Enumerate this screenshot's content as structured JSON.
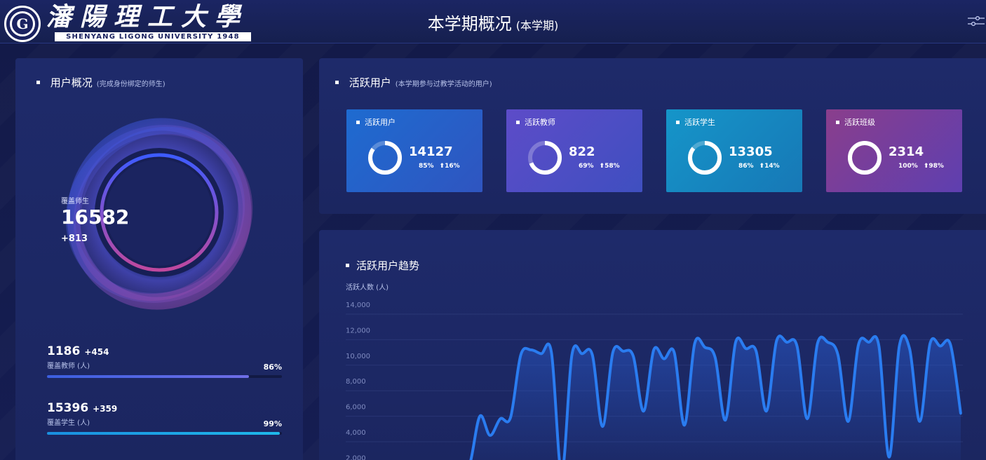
{
  "header": {
    "title": "本学期概况",
    "subtitle": "(本学期)",
    "logo_chinese": "瀋陽理工大學",
    "logo_english": "SHENYANG LIGONG UNIVERSITY 1948",
    "logo_emblem_letter": "G"
  },
  "user_overview": {
    "title": "用户概况",
    "hint": "(完成身份绑定的师生)",
    "ring_label": "覆盖师生",
    "ring_value": "16582",
    "ring_delta": "+813",
    "teachers": {
      "value": "1186",
      "delta": "+454",
      "label": "覆盖教师 (人)",
      "pct_text": "86%",
      "pct": 0.86,
      "color": "#6f6ee6"
    },
    "students": {
      "value": "15396",
      "delta": "+359",
      "label": "覆盖学生 (人)",
      "pct_text": "99%",
      "pct": 0.99,
      "color": "#1fb8ea"
    }
  },
  "active": {
    "title": "活跃用户",
    "hint": "(本学期参与过教学活动的用户)",
    "cards": [
      {
        "title": "活跃用户",
        "value": "14127",
        "pct_text": "85%",
        "up_text": "⬆16%",
        "pct": 0.85,
        "bg_from": "#1e6bd0",
        "bg_to": "#2f55c0"
      },
      {
        "title": "活跃教师",
        "value": "822",
        "pct_text": "69%",
        "up_text": "⬆58%",
        "pct": 0.69,
        "bg_from": "#5d4cc8",
        "bg_to": "#3f4fc0"
      },
      {
        "title": "活跃学生",
        "value": "13305",
        "pct_text": "86%",
        "up_text": "⬆14%",
        "pct": 0.86,
        "bg_from": "#1595c9",
        "bg_to": "#1778b6"
      },
      {
        "title": "活跃班级",
        "value": "2314",
        "pct_text": "100%",
        "up_text": "⬆98%",
        "pct": 1.0,
        "bg_from": "#8a3e8c",
        "bg_to": "#5e3fb0"
      }
    ]
  },
  "trend": {
    "title": "活跃用户趋势"
  },
  "chart_data": {
    "type": "area",
    "title": "活跃用户趋势",
    "ylabel": "活跃人数 (人)",
    "ylim": [
      2000,
      14000
    ],
    "yticks": [
      "14,000",
      "12,000",
      "10,000",
      "8,000",
      "6,000",
      "4,000",
      "2,000"
    ],
    "ytick_values": [
      14000,
      12000,
      10000,
      8000,
      6000,
      4000,
      2000
    ],
    "grid": true,
    "series": [
      {
        "color": "#2a7cf0",
        "values": [
          1800,
          2200,
          6000,
          4500,
          5800,
          5900,
          10800,
          11200,
          10900,
          11000,
          1500,
          10800,
          10900,
          10800,
          5200,
          11000,
          11100,
          10700,
          6400,
          11200,
          10500,
          11000,
          5300,
          11700,
          11400,
          10600,
          5700,
          11800,
          11300,
          11100,
          6400,
          11900,
          11800,
          11500,
          5800,
          11700,
          11800,
          10800,
          5600,
          11600,
          11800,
          11500,
          2800,
          11500,
          11300,
          5600,
          11700,
          11500,
          11600,
          6200
        ]
      }
    ]
  }
}
